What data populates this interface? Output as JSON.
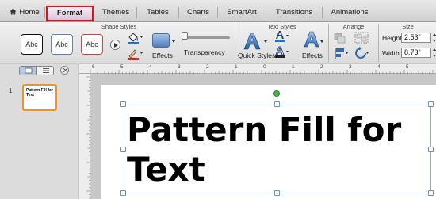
{
  "tabs": [
    {
      "label": "Home"
    },
    {
      "label": "Format",
      "active": true
    },
    {
      "label": "Themes"
    },
    {
      "label": "Tables"
    },
    {
      "label": "Charts"
    },
    {
      "label": "SmartArt"
    },
    {
      "label": "Transitions"
    },
    {
      "label": "Animations"
    }
  ],
  "ribbon": {
    "shape_styles": {
      "title": "Shape Styles",
      "styles": [
        "Abc",
        "Abc",
        "Abc"
      ],
      "effects_label": "Effects",
      "transparency_label": "Transparency"
    },
    "text_styles": {
      "title": "Text Styles",
      "quick_styles_label": "Quick Styles",
      "effects_label": "Effects"
    },
    "arrange": {
      "title": "Arrange"
    },
    "size": {
      "title": "Size",
      "height_label": "Height:",
      "height_value": "2.53\"",
      "width_label": "Width:",
      "width_value": "8.73\""
    }
  },
  "slides_pane": {
    "slide_number": "1",
    "thumb_lines": [
      "Pattern Fill for",
      "Text"
    ]
  },
  "ruler": {
    "labels": [
      "6",
      "5",
      "4",
      "3",
      "2",
      "1",
      "0",
      "1",
      "2",
      "3",
      "4",
      "5"
    ]
  },
  "slide": {
    "text": "Pattern Fill for\nText"
  },
  "colors": {
    "format_tab_highlight": "#e0131b",
    "selected_thumb_border": "#f0922a",
    "rotation_handle": "#4cba4c"
  }
}
